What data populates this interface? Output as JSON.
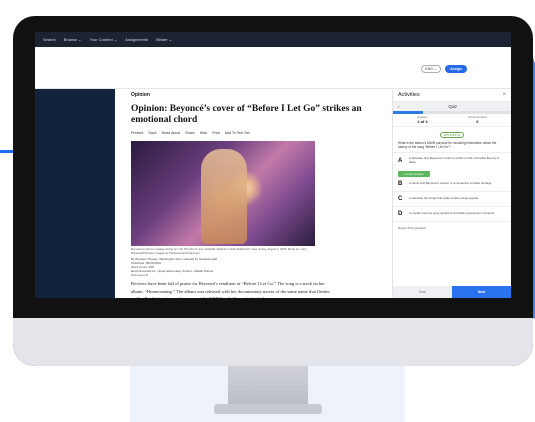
{
  "nav": {
    "items": [
      "Search",
      "Browse ⌄",
      "Your Content ⌄",
      "Assignments",
      "Binder ⌄"
    ]
  },
  "toolbar": {
    "language_label": "ENG ⌄",
    "assign_label": "Assign"
  },
  "article": {
    "section": "Opinion",
    "headline": "Opinion: Beyoncé’s cover of “Before I Let Go” strikes an emotional chord",
    "actions": [
      "Present",
      "Save",
      "Read Aloud",
      "Share",
      "Hide",
      "Print",
      "Add To Text Set"
    ],
    "caption": "Beyoncé performs onstage during her “On The Run II” tour at Metlife Stadium in East Rutherford, New Jersey, August 3, 2018. Photo by: Larry Busacca/PW/Getty Images for Parkwood Entertainment",
    "byline": "By Brandon Tensley, Washington Post, adapted by Newsela staff",
    "published": "Published: 05/01/2019",
    "word_count": "Word Count: 938",
    "recommended": "Recommended for: Upper Elementary School - Middle School",
    "text_level": "Text Level: 8",
    "body": "Reviews have been full of praise for Beyoncé’s rendition of “Before I Let Go.” The song is a track on her album, “Homecoming.” The album was released with her documentary movie of the same name that fleshes out her Earth-stopping performance at the 2018 Coachella music festival."
  },
  "activities": {
    "title": "Activities",
    "quiz_label": "Quiz",
    "question_label": "Question",
    "question_value": "1 of 4",
    "correct_label": "Correct Answers",
    "correct_value": "0",
    "progress_fraction": 0.25,
    "skill": "RI.5.2,RI.5.11",
    "question": "What is the author’s MAIN purpose for including information about the history of the song “Before I Let Go”?",
    "options": [
      {
        "letter": "A",
        "text": "to illustrate how Beyoncé’s music is similar to that of Frankie Beverly & Maze"
      },
      {
        "letter": "B",
        "text": "to show how Beyoncé’s version is a connection to black heritage"
      },
      {
        "letter": "C",
        "text": "to describe the things that make certain songs popular"
      },
      {
        "letter": "D",
        "text": "to explain how the song speaks to the black experience in America"
      }
    ],
    "correct_answer_badge": "Correct Answer",
    "report": "Report This Question",
    "back": "Back",
    "next": "Next"
  },
  "colors": {
    "accent": "#2a73f0",
    "nav_bg": "#1c2434",
    "sidebar_bg": "#12233d",
    "correct": "#5cb85c"
  }
}
